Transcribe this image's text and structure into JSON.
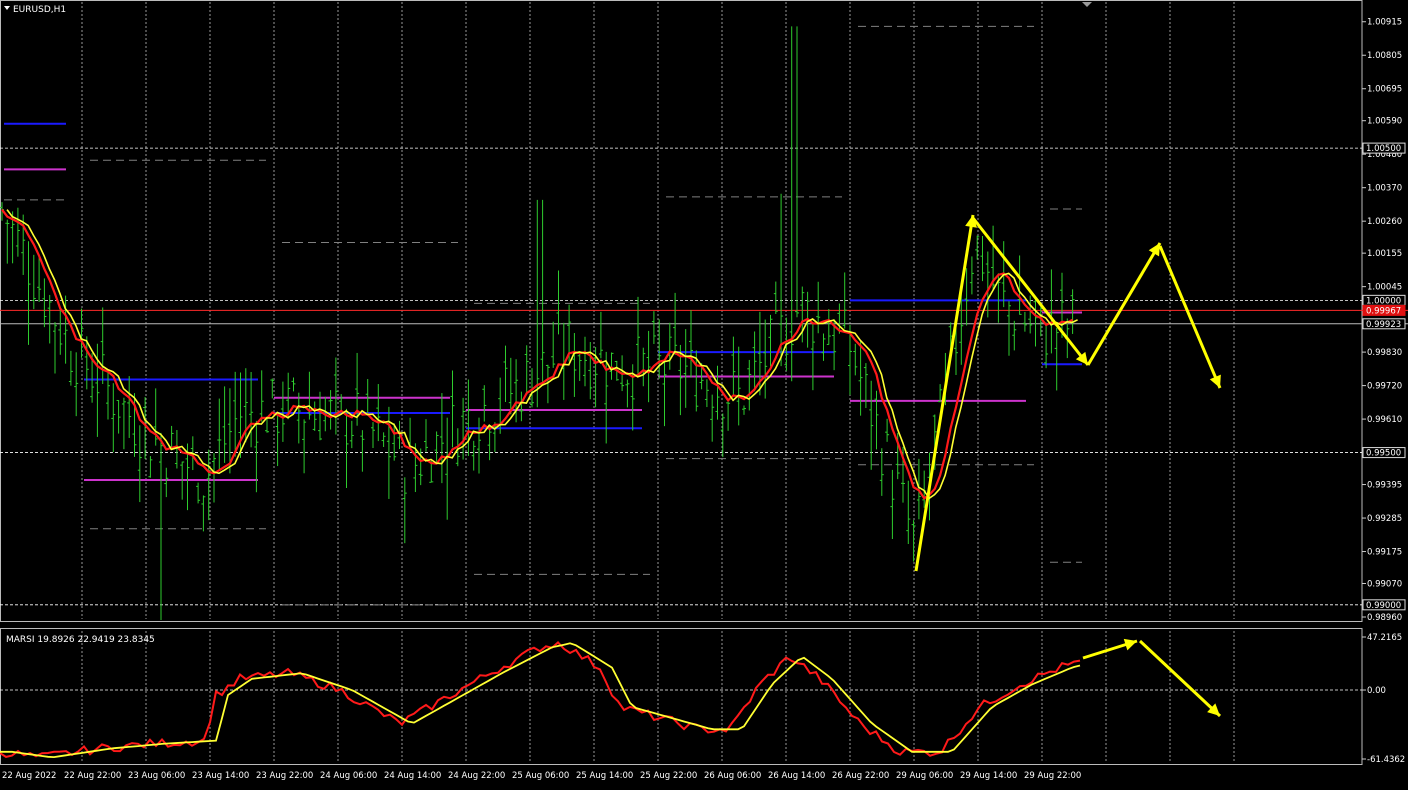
{
  "chart_data": [
    {
      "type": "bar",
      "title": "EURUSD,H1",
      "price_axis": {
        "ylim": [
          0.9896,
          1.0097
        ],
        "tick_labels": [
          "1.00915",
          "1.00805",
          "1.00695",
          "1.00590",
          "1.00480",
          "1.00370",
          "1.00260",
          "1.00155",
          "1.00045",
          "0.99830",
          "0.99720",
          "0.99610",
          "0.99395",
          "0.99285",
          "0.99175",
          "0.99070",
          "0.98960"
        ],
        "tick_values": [
          1.00915,
          1.00805,
          1.00695,
          1.0059,
          1.0048,
          1.0037,
          1.0026,
          1.00155,
          1.00045,
          0.9983,
          0.9972,
          0.9961,
          0.99395,
          0.99285,
          0.99175,
          0.9907,
          0.9896
        ],
        "boxed_labels": [
          {
            "label": "1.00500",
            "value": 1.005,
            "style": "box"
          },
          {
            "label": "1.00000",
            "value": 1.0,
            "style": "box"
          },
          {
            "label": "0.99967",
            "value": 0.99967,
            "style": "red"
          },
          {
            "label": "0.99923",
            "value": 0.99923,
            "style": "box"
          },
          {
            "label": "0.99500",
            "value": 0.995,
            "style": "box"
          },
          {
            "label": "0.99000",
            "value": 0.99,
            "style": "box"
          }
        ]
      },
      "grid": true,
      "horizontal_dotted_levels": [
        1.005,
        1.0,
        0.995,
        0.99
      ],
      "x_labels": [
        "22 Aug 2022",
        "22 Aug 22:00",
        "23 Aug 06:00",
        "23 Aug 14:00",
        "23 Aug 22:00",
        "24 Aug 06:00",
        "24 Aug 14:00",
        "24 Aug 22:00",
        "25 Aug 06:00",
        "25 Aug 14:00",
        "25 Aug 22:00",
        "26 Aug 06:00",
        "26 Aug 14:00",
        "26 Aug 22:00",
        "29 Aug 06:00",
        "29 Aug 14:00",
        "29 Aug 22:00"
      ],
      "colors": {
        "bars": "#2ecc2e",
        "ma_red": "#ff1a1a",
        "ma_yellow": "#ffff33",
        "arrows": "#ffff00",
        "blue": "#1a1aff",
        "magenta": "#cc33cc",
        "grey": "#808080",
        "grid": "#ffffff"
      }
    },
    {
      "type": "line",
      "title": "MARSI 19.8926 22.9419 23.8345",
      "ylim": [
        -61.4362,
        47.2165
      ],
      "tick_labels": [
        "47.2165",
        "0.00",
        "-61.4362"
      ],
      "tick_values": [
        47.2165,
        0,
        -61.4362
      ]
    }
  ]
}
